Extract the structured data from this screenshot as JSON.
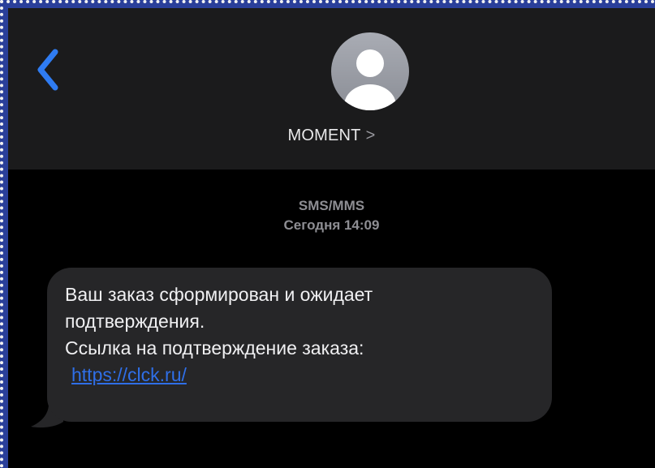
{
  "header": {
    "contact_name": "MOMENT",
    "contact_chevron": ">",
    "back_icon": "chevron-left-icon",
    "avatar_icon": "person-icon"
  },
  "thread": {
    "service": "SMS/MMS",
    "timestamp": "Сегодня 14:09"
  },
  "message": {
    "line1": "Ваш заказ сформирован и ожидает",
    "line2": "подтверждения.",
    "line3": "Ссылка на подтверждение заказа:",
    "link": "https://clck.ru/"
  },
  "colors": {
    "accent": "#1f6fe8",
    "bubble": "#262628",
    "background": "#000000"
  }
}
